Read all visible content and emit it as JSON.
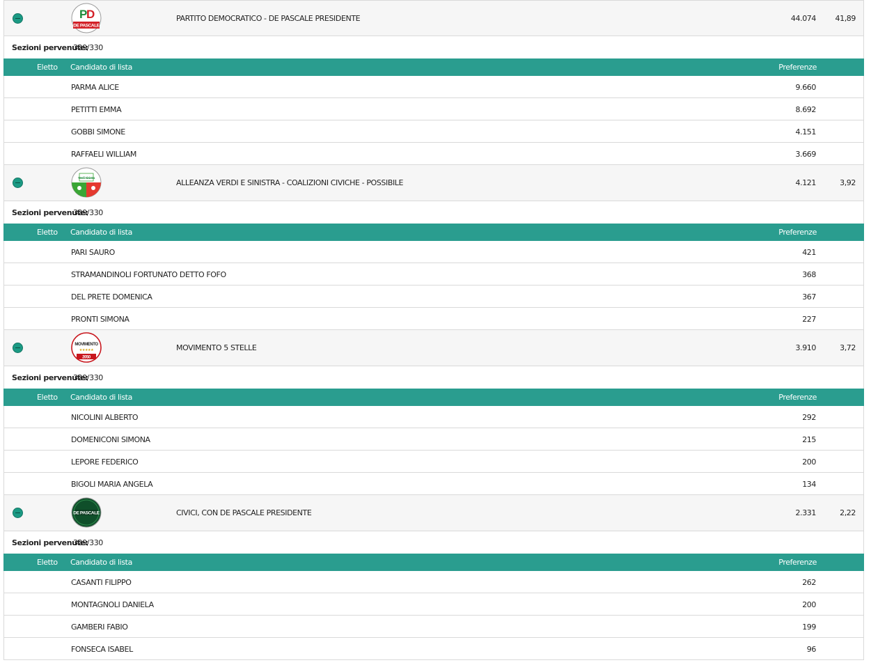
{
  "table_headers": {
    "elected": "Eletto",
    "candidate": "Candidato di lista",
    "preferences": "Preferenze"
  },
  "sections_label": "Sezioni pervenute:",
  "parties": [
    {
      "name": "PARTITO DEMOCRATICO - DE PASCALE PRESIDENTE",
      "votes": "44.074",
      "pct": "41,89",
      "logo": "pd-depascale-logo",
      "logo_text": "DE PASCALE",
      "sections": "329/330",
      "candidates": [
        {
          "name": "PARMA ALICE",
          "pref": "9.660"
        },
        {
          "name": "PETITTI EMMA",
          "pref": "8.692"
        },
        {
          "name": "GOBBI SIMONE",
          "pref": "4.151"
        },
        {
          "name": "RAFFAELI WILLIAM",
          "pref": "3.669"
        }
      ]
    },
    {
      "name": "ALLEANZA VERDI E SINISTRA - COALIZIONI CIVICHE - POSSIBILE",
      "votes": "4.121",
      "pct": "3,92",
      "logo": "avs-logo",
      "logo_text": "Verdi Sinistra",
      "sections": "329/330",
      "candidates": [
        {
          "name": "PARI SAURO",
          "pref": "421"
        },
        {
          "name": "STRAMANDINOLI FORTUNATO DETTO FOFO",
          "pref": "368"
        },
        {
          "name": "DEL PRETE DOMENICA",
          "pref": "367"
        },
        {
          "name": "PRONTI SIMONA",
          "pref": "227"
        }
      ]
    },
    {
      "name": "MOVIMENTO 5 STELLE",
      "votes": "3.910",
      "pct": "3,72",
      "logo": "m5s-logo",
      "logo_text": "MOVIMENTO",
      "logo_text2": "2050",
      "sections": "329/330",
      "candidates": [
        {
          "name": "NICOLINI ALBERTO",
          "pref": "292"
        },
        {
          "name": "DOMENICONI SIMONA",
          "pref": "215"
        },
        {
          "name": "LEPORE FEDERICO",
          "pref": "200"
        },
        {
          "name": "BIGOLI MARIA ANGELA",
          "pref": "134"
        }
      ]
    },
    {
      "name": "CIVICI, CON DE PASCALE PRESIDENTE",
      "votes": "2.331",
      "pct": "2,22",
      "logo": "civici-logo",
      "logo_text": "DE PASCALE",
      "sections": "329/330",
      "candidates": [
        {
          "name": "CASANTI FILIPPO",
          "pref": "262"
        },
        {
          "name": "MONTAGNOLI DANIELA",
          "pref": "200"
        },
        {
          "name": "GAMBERI FABIO",
          "pref": "199"
        },
        {
          "name": "FONSECA ISABEL",
          "pref": "96"
        }
      ]
    }
  ]
}
